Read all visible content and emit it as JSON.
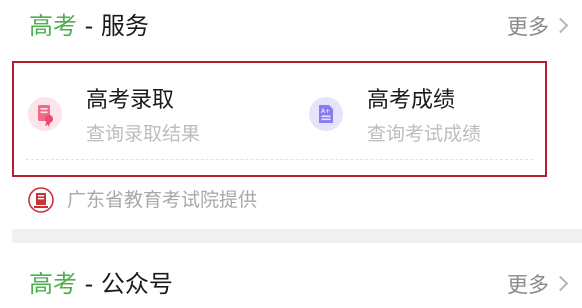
{
  "service_section": {
    "title_accent": "高考",
    "title_rest": " - 服务",
    "more_label": "更多"
  },
  "cards": [
    {
      "title": "高考录取",
      "subtitle": "查询录取结果",
      "icon": "document-seal-icon",
      "icon_color": "#f06b86"
    },
    {
      "title": "高考成绩",
      "subtitle": "查询考试成绩",
      "icon": "grade-sheet-icon",
      "icon_color": "#8a7cf0"
    }
  ],
  "provider": {
    "text": "广东省教育考试院提供",
    "icon": "exam-authority-logo-icon"
  },
  "public_section": {
    "title_accent": "高考",
    "title_rest": " - 公众号",
    "more_label": "更多"
  },
  "colors": {
    "accent_green": "#4caf50",
    "highlight_border": "#b3202a"
  }
}
